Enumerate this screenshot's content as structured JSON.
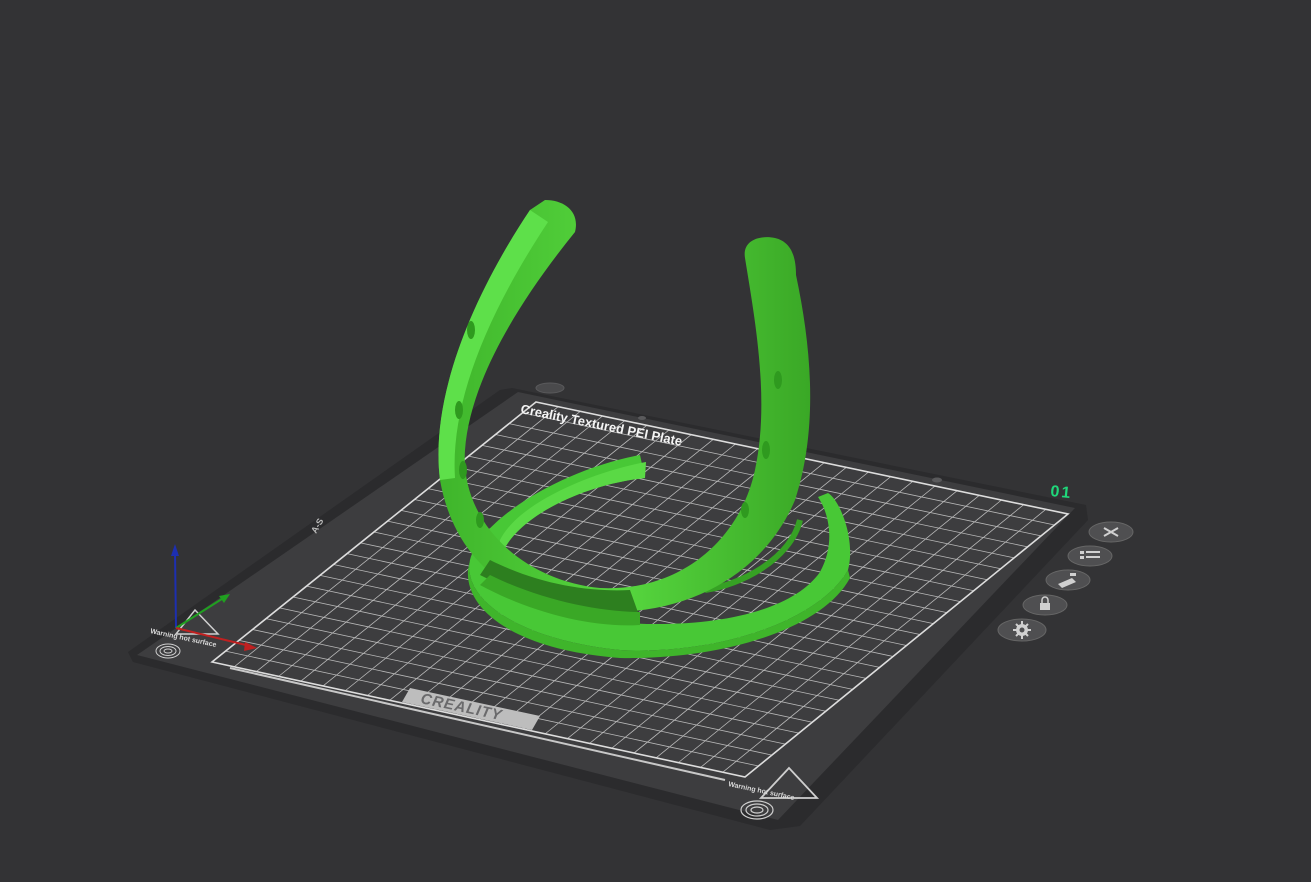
{
  "viewport": {
    "background": "#333335"
  },
  "build_plate": {
    "plate_name": "Creality Textured PEI Plate",
    "brand": "CREALITY",
    "plate_number": "01",
    "edge_label": "A-S",
    "warning_text": "Warning hot surface",
    "plate_color": "#3c3c3e",
    "grid_color": "#d9d9d9"
  },
  "model": {
    "name": "horseshoe",
    "color": "#4fcf3a"
  },
  "plate_toolbar": [
    {
      "icon": "close-icon",
      "label": "delete"
    },
    {
      "icon": "arrange-icon",
      "label": "arrange"
    },
    {
      "icon": "auto-orient-icon",
      "label": "orient"
    },
    {
      "icon": "lock-icon",
      "label": "lock"
    },
    {
      "icon": "gear-icon",
      "label": "settings"
    }
  ],
  "axis_gizmo": {
    "x_color": "#c02020",
    "y_color": "#20a020",
    "z_color": "#1d2fb0"
  }
}
